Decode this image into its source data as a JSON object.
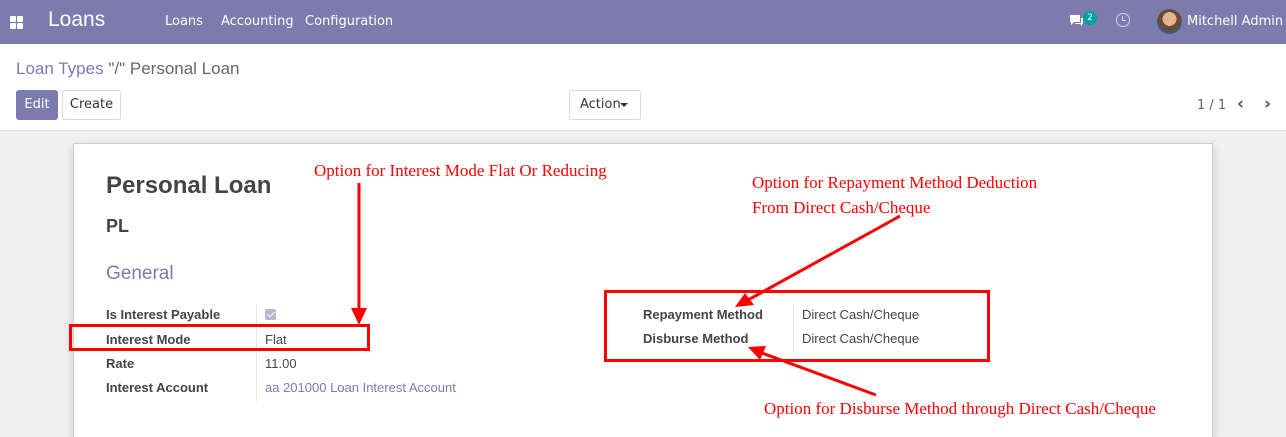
{
  "navbar": {
    "app_name": "Loans",
    "menu": [
      "Loans",
      "Accounting",
      "Configuration"
    ],
    "chat_badge": "2",
    "user_name": "Mitchell Admin"
  },
  "control_panel": {
    "breadcrumb_parent": "Loan Types",
    "breadcrumb_separator": "\"/\"",
    "breadcrumb_current": "Personal Loan",
    "edit_label": "Edit",
    "create_label": "Create",
    "action_label": "Action",
    "pager_value": "1 / 1"
  },
  "form": {
    "name": "Personal Loan",
    "code": "PL",
    "group_title": "General",
    "is_interest_payable_label": "Is Interest Payable",
    "is_interest_payable": true,
    "interest_mode_label": "Interest Mode",
    "interest_mode_value": "Flat",
    "rate_label": "Rate",
    "rate_value": "11.00",
    "interest_account_label": "Interest Account",
    "interest_account_value": "aa 201000 Loan Interest Account",
    "repayment_method_label": "Repayment Method",
    "repayment_method_value": "Direct Cash/Cheque",
    "disburse_method_label": "Disburse Method",
    "disburse_method_value": "Direct Cash/Cheque"
  },
  "annotations": {
    "interest_mode_note": "Option for Interest Mode Flat Or Reducing",
    "repayment_note_line1": "Option for Repayment Method Deduction",
    "repayment_note_line2": "From Direct Cash/Cheque",
    "disburse_note": "Option for Disburse Method through Direct Cash/Cheque",
    "color": "#ff0000"
  },
  "colors": {
    "brand": "#7c7bad",
    "badge": "#00a09d"
  }
}
